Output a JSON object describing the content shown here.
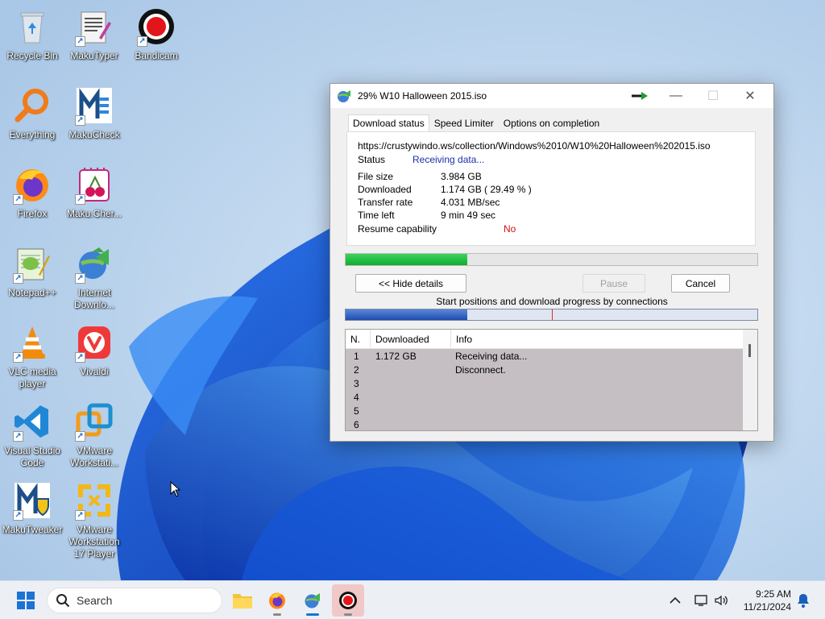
{
  "desktop": {
    "icons": [
      {
        "label": "Recycle Bin",
        "icon": "recycle-bin-icon"
      },
      {
        "label": "MakuTyper",
        "icon": "makutyper-icon"
      },
      {
        "label": "Bandicam",
        "icon": "bandicam-icon"
      },
      {
        "label": "Everything",
        "icon": "everything-search-icon"
      },
      {
        "label": "MakuCheck",
        "icon": "makucheck-icon"
      },
      {
        "label": "Firefox",
        "icon": "firefox-icon"
      },
      {
        "label": "Maku.Cher...",
        "icon": "makucherry-icon"
      },
      {
        "label": "Notepad++",
        "icon": "notepad-plus-plus-icon"
      },
      {
        "label": "Internet Downlo...",
        "icon": "internet-download-manager-icon"
      },
      {
        "label": "VLC media player",
        "icon": "vlc-icon"
      },
      {
        "label": "Vivaldi",
        "icon": "vivaldi-icon"
      },
      {
        "label": "Visual Studio Code",
        "icon": "vscode-icon"
      },
      {
        "label": "VMware Workstati...",
        "icon": "vmware-workstation-icon"
      },
      {
        "label": "MakuTweaker",
        "icon": "makutweaker-icon"
      },
      {
        "label": "VMware Workstation 17 Player",
        "icon": "vmware-player-icon"
      }
    ]
  },
  "idm_window": {
    "title": "29% W10 Halloween 2015.iso",
    "tabs": [
      "Download status",
      "Speed Limiter",
      "Options on completion"
    ],
    "url": "https://crustywindo.ws/collection/Windows%2010/W10%20Halloween%202015.iso",
    "status_label": "Status",
    "status_value": "Receiving data...",
    "file_size_label": "File size",
    "file_size_value": "3.984  GB",
    "downloaded_label": "Downloaded",
    "downloaded_value": "1.174  GB  ( 29.49 % )",
    "transfer_rate_label": "Transfer rate",
    "transfer_rate_value": "4.031  MB/sec",
    "time_left_label": "Time left",
    "time_left_value": "9 min 49 sec",
    "resume_label": "Resume capability",
    "resume_value": "No",
    "progress_percent": 29.49,
    "buttons": {
      "hide_details": "<< Hide details",
      "pause": "Pause",
      "cancel": "Cancel"
    },
    "connections_label": "Start positions and download progress by connections",
    "connections_progress": [
      {
        "start": 0.0,
        "progress": 0.295
      },
      {
        "start": 0.5,
        "progress": 0.0
      }
    ],
    "table": {
      "headers": [
        "N.",
        "Downloaded",
        "Info"
      ],
      "rows": [
        {
          "n": "1",
          "downloaded": "1.172  GB",
          "info": "Receiving data..."
        },
        {
          "n": "2",
          "downloaded": "",
          "info": "Disconnect."
        },
        {
          "n": "3",
          "downloaded": "",
          "info": ""
        },
        {
          "n": "4",
          "downloaded": "",
          "info": ""
        },
        {
          "n": "5",
          "downloaded": "",
          "info": ""
        },
        {
          "n": "6",
          "downloaded": "",
          "info": ""
        }
      ]
    }
  },
  "taskbar": {
    "search_label": "Search",
    "time": "9:25 AM",
    "date": "11/21/2024",
    "colors": {
      "idm_progress": "#16b535",
      "bandicam_highlight": "#f0c8c8"
    }
  }
}
